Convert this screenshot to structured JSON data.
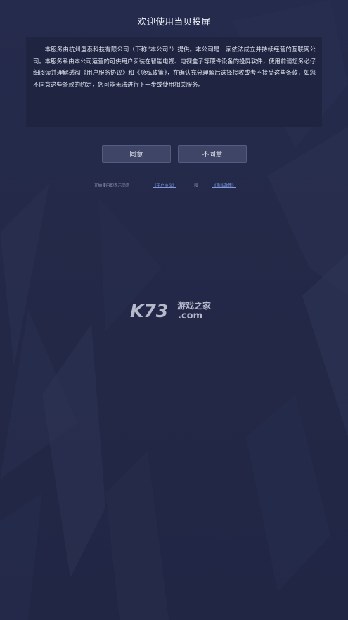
{
  "dialog": {
    "title": "欢迎使用当贝投屏",
    "terms_text": "本服务由杭州盟泰科技有限公司（下称“本公司”）提供。本公司是一家依法成立并持续经营的互联网公司。本服务系由本公司运营的可供用户安装在智能电视、电视盒子等硬件设备的投屏软件，使用前请您务必仔细阅读并理解透彻《用户服务协议》和《隐私政策》，在确认充分理解后选择接收或者不接受这些条款，如您不同意这些条款的约定，您可能无法进行下一步或使用相关服务。",
    "agree_label": "同意",
    "disagree_label": "不同意"
  },
  "notice": {
    "prefix": "开始使用即表示同意",
    "user_agreement_link": "《用户协议》",
    "conjunction": "和",
    "privacy_policy_link": "《隐私政策》"
  },
  "watermark": {
    "logo_text": "K73",
    "tagline": "游戏之家",
    "domain": ".com",
    "icon": "k73-logo-icon"
  },
  "colors": {
    "background": "#232948",
    "panel": "#1e233e",
    "button": "#3f4566",
    "link": "#7f9ae0"
  }
}
